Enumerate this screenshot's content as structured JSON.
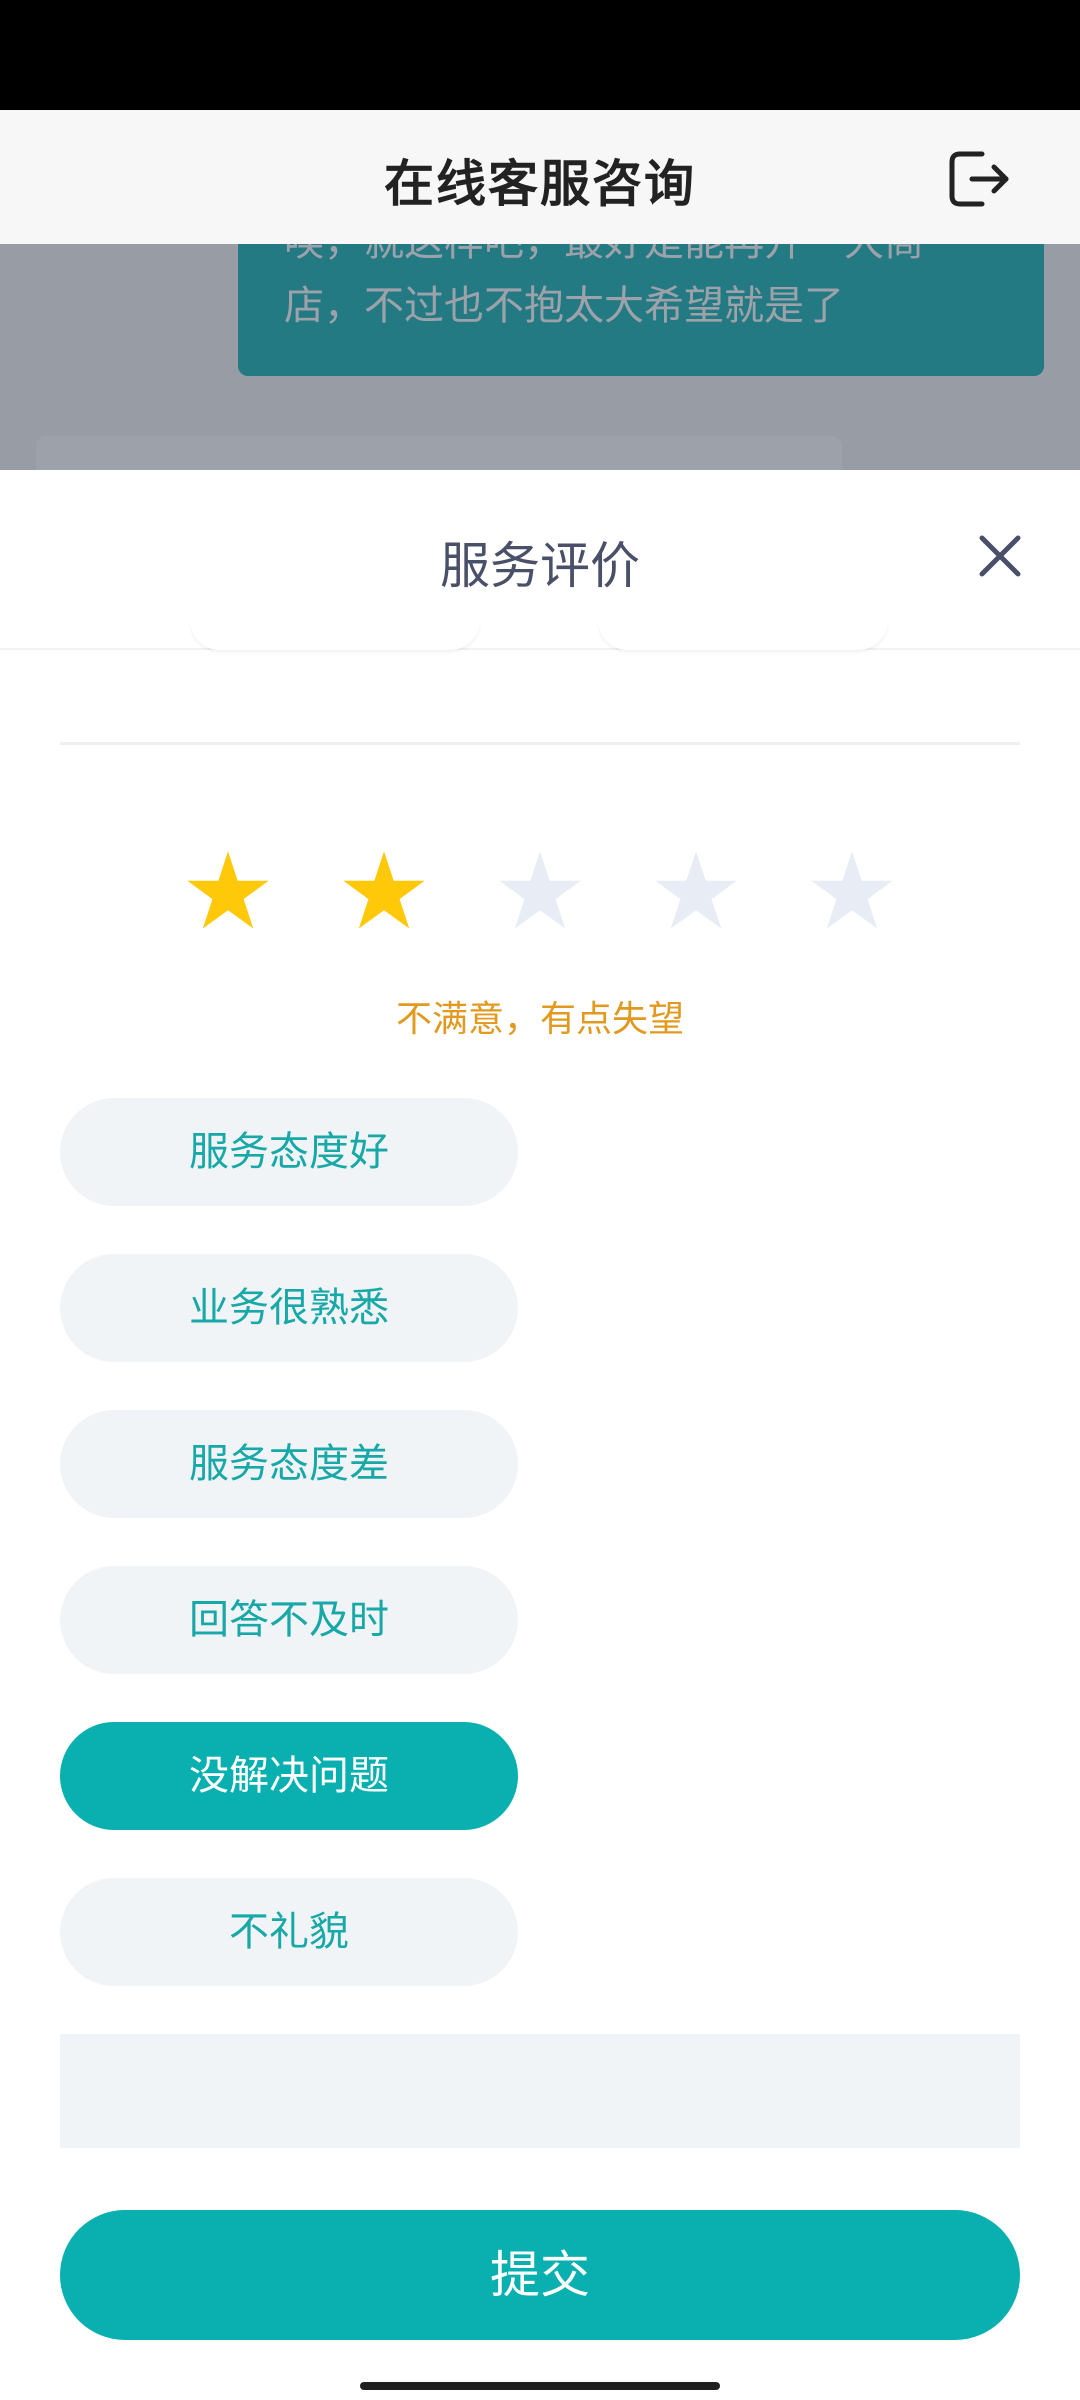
{
  "header": {
    "title": "在线客服咨询",
    "exit_icon": "logout-icon"
  },
  "chat": {
    "bubble_text": "唉，就这样吧，最好是能再开一大商\n店，不过也不抱太大希望就是了"
  },
  "sheet": {
    "title": "服务评价",
    "close_icon": "close-icon",
    "rating": {
      "value": 2,
      "max": 5,
      "text": "不满意，有点失望",
      "star_glyph": "★",
      "filled_color": "#ffc909",
      "empty_color": "#e8ecf5"
    },
    "tags": [
      {
        "label": "服务态度好",
        "selected": false
      },
      {
        "label": "业务很熟悉",
        "selected": false
      },
      {
        "label": "服务态度差",
        "selected": false
      },
      {
        "label": "回答不及时",
        "selected": false
      },
      {
        "label": "没解决问题",
        "selected": true
      },
      {
        "label": "不礼貌",
        "selected": false
      }
    ],
    "comment": {
      "value": "",
      "placeholder": ""
    },
    "submit_label": "提交"
  },
  "colors": {
    "accent": "#0ab0b0",
    "rating_text": "#e19a1f",
    "tag_bg": "#f1f4f7",
    "tag_text": "#17a8a7"
  }
}
